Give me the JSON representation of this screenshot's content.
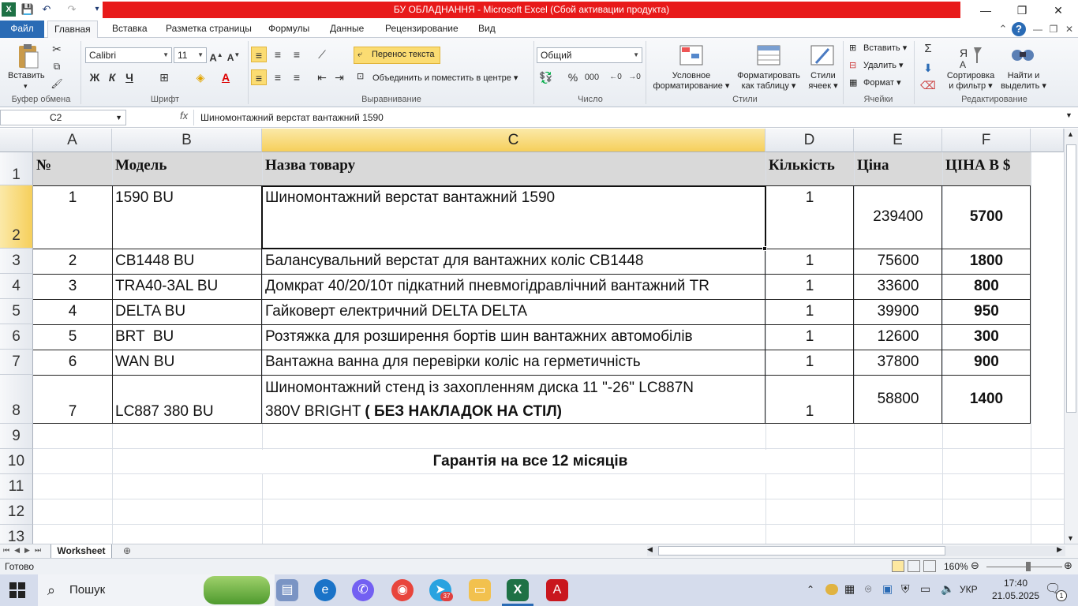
{
  "window": {
    "title": "БУ ОБЛАДНАННЯ  -  Microsoft Excel (Сбой активации продукта)"
  },
  "ribbon_tabs": [
    "Файл",
    "Главная",
    "Вставка",
    "Разметка страницы",
    "Формулы",
    "Данные",
    "Рецензирование",
    "Вид"
  ],
  "ribbon": {
    "clipboard": {
      "paste": "Вставить",
      "label": "Буфер обмена"
    },
    "font": {
      "name": "Calibri",
      "size": "11",
      "bold": "Ж",
      "italic": "К",
      "underline": "Ч",
      "label": "Шрифт"
    },
    "alignment": {
      "wrap": "Перенос текста",
      "merge": "Объединить и поместить в центре",
      "label": "Выравнивание"
    },
    "number": {
      "format": "Общий",
      "percent": "%",
      "thousands": "000",
      "label": "Число"
    },
    "styles": {
      "conditional": [
        "Условное",
        "форматирование"
      ],
      "table": [
        "Форматировать",
        "как таблицу"
      ],
      "cell": [
        "Стили",
        "ячеек"
      ],
      "label": "Стили"
    },
    "cells": {
      "insert": "Вставить",
      "delete": "Удалить",
      "format": "Формат",
      "label": "Ячейки"
    },
    "editing": {
      "sort": [
        "Сортировка",
        "и фильтр"
      ],
      "find": [
        "Найти и",
        "выделить"
      ],
      "label": "Редактирование"
    }
  },
  "formula_bar": {
    "name_box": "C2",
    "fx": "fx",
    "formula": "Шиномонтажний верстат вантажний 1590"
  },
  "columns": [
    "A",
    "B",
    "C",
    "D",
    "E",
    "F"
  ],
  "rows": [
    "1",
    "2",
    "3",
    "4",
    "5",
    "6",
    "7",
    "8",
    "9",
    "10",
    "11",
    "12",
    "13"
  ],
  "table": {
    "headers": {
      "num": "№",
      "model": "Модель",
      "name": "Назва товару",
      "qty": "Кількість",
      "price": "Ціна",
      "price_usd": "ЦІНА В $"
    },
    "rows": [
      {
        "num": "1",
        "model": "1590 BU",
        "name": "Шиномонтажний верстат вантажний 1590",
        "qty": "1",
        "price": "239400",
        "usd": "5700"
      },
      {
        "num": "2",
        "model": "CB1448 BU",
        "name": "Балансувальний верстат для вантажних коліс CB1448",
        "qty": "1",
        "price": "75600",
        "usd": "1800"
      },
      {
        "num": "3",
        "model": "TRA40-3AL BU",
        "name": "Домкрат 40/20/10т підкатний пневмогідравлічний вантажний TR",
        "qty": "1",
        "price": "33600",
        "usd": "800"
      },
      {
        "num": "4",
        "model": "DELTA BU",
        "name": "Гайковерт електричний DELTA DELTA",
        "qty": "1",
        "price": "39900",
        "usd": "950"
      },
      {
        "num": "5",
        "model": "BRT  BU",
        "name": "Розтяжка для розширення бортів шин вантажних автомобілів",
        "qty": "1",
        "price": "12600",
        "usd": "300"
      },
      {
        "num": "6",
        "model": "WAN BU",
        "name": "Вантажна ванна для перевірки коліс на герметичність",
        "qty": "1",
        "price": "37800",
        "usd": "900"
      },
      {
        "num": "7",
        "model": "LC887 380 BU",
        "name_line1": "Шиномонтажний стенд із захопленням диска 11 \"-26\" LC887N",
        "name_line2": "380V BRIGHT ",
        "name_bold": "( БЕЗ НАКЛАДОК НА СТІЛ)",
        "qty": "1",
        "price": "58800",
        "usd": "1400"
      }
    ],
    "warranty": "Гарантія на все 12 місяців"
  },
  "sheet_tab": "Worksheet",
  "status": {
    "ready": "Готово",
    "zoom": "160%"
  },
  "taskbar": {
    "search": "Пошук",
    "lang": "УКР",
    "time": "17:40",
    "date": "21.05.2025",
    "notif_count": "1",
    "telegram_badge": "37"
  },
  "colors": {
    "title_red": "#e81a1a",
    "file_tab": "#2a6bb5",
    "header_fill": "#d9d9d9",
    "selected_header": "#f6cf5b",
    "wrap_highlight": "#fbdc72"
  }
}
